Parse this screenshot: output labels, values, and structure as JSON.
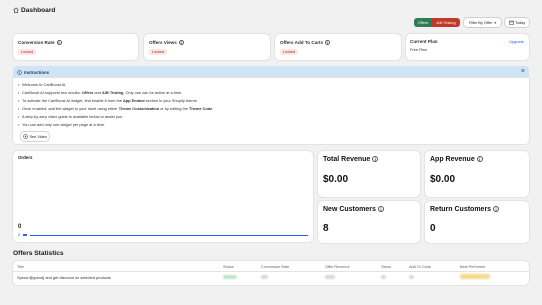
{
  "header": {
    "home_icon": "home-icon",
    "title": "Dashboard"
  },
  "toolbar": {
    "toggle_offers": "Offers",
    "toggle_ab": "A/B Testing",
    "filter_label": "Filter By Offer",
    "filter_chevron": "chevron-down-icon",
    "today_label": "Today",
    "today_icon": "calendar-icon",
    "accent_green": "#2e7d57",
    "accent_red": "#c0392b"
  },
  "stats": [
    {
      "label": "Conversion Rate",
      "badge": "Locked"
    },
    {
      "label": "Offers Views",
      "badge": "Locked"
    },
    {
      "label": "Offers Add To Carts",
      "badge": "Locked"
    }
  ],
  "plan": {
    "title": "Current Plan",
    "name": "Free Plan",
    "upgrade": "Upgrade"
  },
  "instructions": {
    "title": "Instructions",
    "b1": "Welcome to CartBoost AI.",
    "b2_pre": "CartBoost AI supports two modes: ",
    "b2_m1": "Offers",
    "b2_and": " and ",
    "b2_m2": "A/B Testing",
    "b2_post": ". Only one can be active at a time.",
    "b3_pre": "To activate the CartBoost AI widget, find enable it from the ",
    "b3_bold": "App Embed",
    "b3_post": " section in your Shopify theme.",
    "b4_pre": "Once enabled, add the widget to your store using either ",
    "b4_bold1": "Theme Customization",
    "b4_mid": " or by editing the ",
    "b4_bold2": "Theme Code",
    "b4_post": ".",
    "b5": "A step-by-step video guide is available below to assist you.",
    "b6": "You can add only one widget per page at a time.",
    "video_btn": "See Video"
  },
  "orders": {
    "title": "Orders",
    "value": "0",
    "axis_label": "0"
  },
  "metrics": [
    {
      "title": "Total Revenue",
      "value": "$0.00"
    },
    {
      "title": "App Revenue",
      "value": "$0.00"
    },
    {
      "title": "New Customers",
      "value": "8"
    },
    {
      "title": "Return Customers",
      "value": "0"
    }
  ],
  "offers_stats": {
    "title": "Offers Statistics",
    "headers": [
      "Title",
      "Status",
      "Conversion Rate",
      "Offer Revenue",
      "Views",
      "Add To Carts",
      "Best Performer"
    ],
    "rows": [
      {
        "title": "Spend $[spend] and get discount on selected products"
      }
    ]
  }
}
